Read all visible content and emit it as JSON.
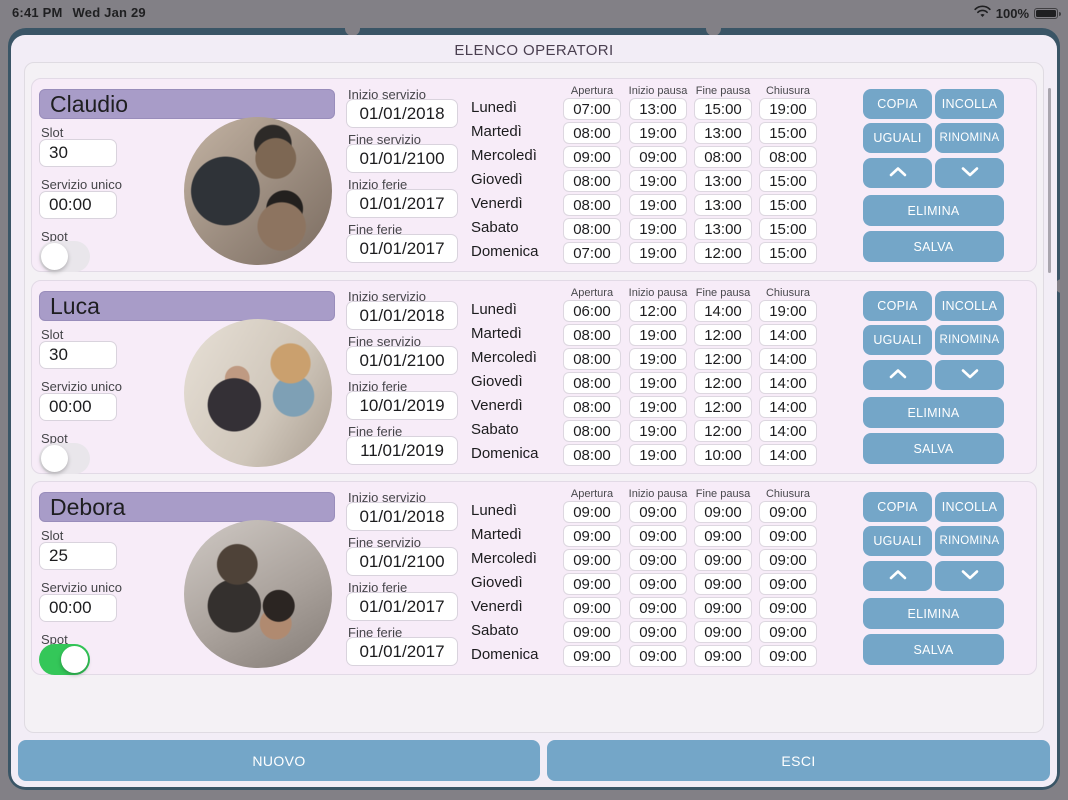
{
  "status_bar": {
    "time": "6:41 PM",
    "date": "Wed Jan 29",
    "battery_percent": "100%",
    "wifi_icon": "wifi",
    "battery_icon": "battery-full"
  },
  "header": {
    "title": "ELENCO OPERATORI"
  },
  "labels": {
    "slot": "Slot",
    "servizio_unico": "Servizio unico",
    "spot": "Spot",
    "inizio_servizio": "Inizio servizio",
    "fine_servizio": "Fine servizio",
    "inizio_ferie": "Inizio ferie",
    "fine_ferie": "Fine ferie"
  },
  "days": [
    "Lunedì",
    "Martedì",
    "Mercoledì",
    "Giovedì",
    "Venerdì",
    "Sabato",
    "Domenica"
  ],
  "time_columns": [
    "Apertura",
    "Inizio pausa",
    "Fine pausa",
    "Chiusura"
  ],
  "card_buttons": {
    "copia": "COPIA",
    "incolla": "INCOLLA",
    "uguali": "UGUALI",
    "rinomina": "RINOMINA",
    "move_up_icon": "chevron-up",
    "move_down_icon": "chevron-down",
    "elimina": "ELIMINA",
    "salva": "SALVA"
  },
  "operators": [
    {
      "name": "Claudio",
      "slot": "30",
      "servizio_unico": "00:00",
      "spot_on": false,
      "inizio_servizio": "01/01/2018",
      "fine_servizio": "01/01/2100",
      "inizio_ferie": "01/01/2017",
      "fine_ferie": "01/01/2017",
      "schedule": [
        [
          "07:00",
          "13:00",
          "15:00",
          "19:00"
        ],
        [
          "08:00",
          "19:00",
          "13:00",
          "15:00"
        ],
        [
          "09:00",
          "09:00",
          "08:00",
          "08:00"
        ],
        [
          "08:00",
          "19:00",
          "13:00",
          "15:00"
        ],
        [
          "08:00",
          "19:00",
          "13:00",
          "15:00"
        ],
        [
          "08:00",
          "19:00",
          "13:00",
          "15:00"
        ],
        [
          "07:00",
          "19:00",
          "12:00",
          "15:00"
        ]
      ]
    },
    {
      "name": "Luca",
      "slot": "30",
      "servizio_unico": "00:00",
      "spot_on": false,
      "inizio_servizio": "01/01/2018",
      "fine_servizio": "01/01/2100",
      "inizio_ferie": "10/01/2019",
      "fine_ferie": "11/01/2019",
      "schedule": [
        [
          "06:00",
          "12:00",
          "14:00",
          "19:00"
        ],
        [
          "08:00",
          "19:00",
          "12:00",
          "14:00"
        ],
        [
          "08:00",
          "19:00",
          "12:00",
          "14:00"
        ],
        [
          "08:00",
          "19:00",
          "12:00",
          "14:00"
        ],
        [
          "08:00",
          "19:00",
          "12:00",
          "14:00"
        ],
        [
          "08:00",
          "19:00",
          "12:00",
          "14:00"
        ],
        [
          "08:00",
          "19:00",
          "10:00",
          "14:00"
        ]
      ]
    },
    {
      "name": "Debora",
      "slot": "25",
      "servizio_unico": "00:00",
      "spot_on": true,
      "inizio_servizio": "01/01/2018",
      "fine_servizio": "01/01/2100",
      "inizio_ferie": "01/01/2017",
      "fine_ferie": "01/01/2017",
      "schedule": [
        [
          "09:00",
          "09:00",
          "09:00",
          "09:00"
        ],
        [
          "09:00",
          "09:00",
          "09:00",
          "09:00"
        ],
        [
          "09:00",
          "09:00",
          "09:00",
          "09:00"
        ],
        [
          "09:00",
          "09:00",
          "09:00",
          "09:00"
        ],
        [
          "09:00",
          "09:00",
          "09:00",
          "09:00"
        ],
        [
          "09:00",
          "09:00",
          "09:00",
          "09:00"
        ],
        [
          "09:00",
          "09:00",
          "09:00",
          "09:00"
        ]
      ]
    }
  ],
  "footer": {
    "nuovo": "NUOVO",
    "esci": "ESCI"
  },
  "colors": {
    "accent_blue": "#74a6c8",
    "name_bar_purple": "#a89cc8",
    "toggle_on_green": "#34c759",
    "frame_teal": "#3a5566",
    "panel_lavender": "#f2edf6",
    "card_pink": "#f7ecf8"
  }
}
